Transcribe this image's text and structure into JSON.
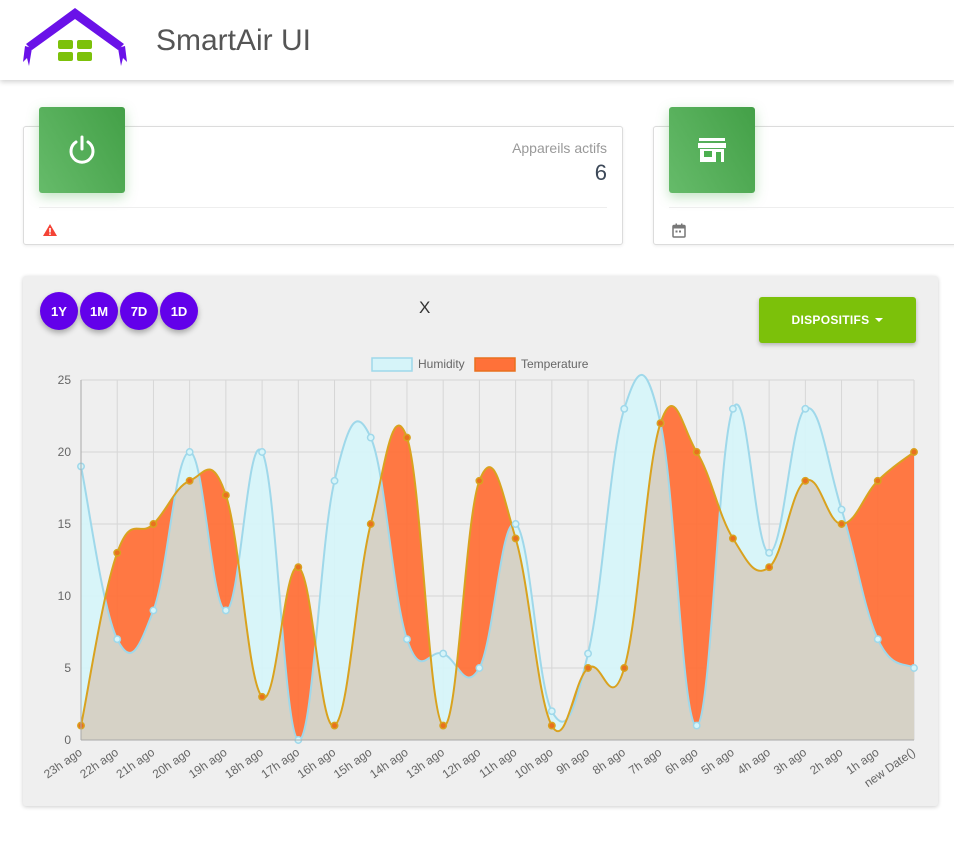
{
  "header": {
    "title": "SmartAir UI"
  },
  "cards": [
    {
      "category": "Appareils actifs",
      "value": "6",
      "icon": "power-icon",
      "footer_icon": "warning-icon"
    },
    {
      "category": "",
      "value": "",
      "icon": "store-icon",
      "footer_icon": "calendar-icon"
    }
  ],
  "chart_card": {
    "periods": [
      "1Y",
      "1M",
      "7D",
      "1D"
    ],
    "title": "X",
    "dropdown_label": "DISPOSITIFS"
  },
  "colors": {
    "accent": "#6200ea",
    "green": "#7cc10a",
    "card_icon": "#4caf50",
    "humidity_fill": "#d6f4f9",
    "humidity_line": "#9fd8ea",
    "temperature_fill": "#ff7139",
    "temperature_line": "#d9a21f"
  },
  "chart_data": {
    "type": "area",
    "categories": [
      "23h ago",
      "22h ago",
      "21h ago",
      "20h ago",
      "19h ago",
      "18h ago",
      "17h ago",
      "16h ago",
      "15h ago",
      "14h ago",
      "13h ago",
      "12h ago",
      "11h ago",
      "10h ago",
      "9h ago",
      "8h ago",
      "7h ago",
      "6h ago",
      "5h ago",
      "4h ago",
      "3h ago",
      "2h ago",
      "1h ago",
      "new Date()"
    ],
    "series": [
      {
        "name": "Humidity",
        "values": [
          19,
          7,
          9,
          20,
          9,
          20,
          0,
          18,
          21,
          7,
          6,
          5,
          15,
          2,
          6,
          23,
          22,
          1,
          23,
          13,
          23,
          16,
          7,
          5
        ]
      },
      {
        "name": "Temperature",
        "values": [
          1,
          13,
          15,
          18,
          17,
          3,
          12,
          1,
          15,
          21,
          1,
          18,
          14,
          1,
          5,
          5,
          22,
          20,
          14,
          12,
          18,
          15,
          18,
          20
        ]
      }
    ],
    "ylim": [
      0,
      25
    ],
    "yticks": [
      0,
      5,
      10,
      15,
      20,
      25
    ],
    "grid": true,
    "legend": "top"
  }
}
